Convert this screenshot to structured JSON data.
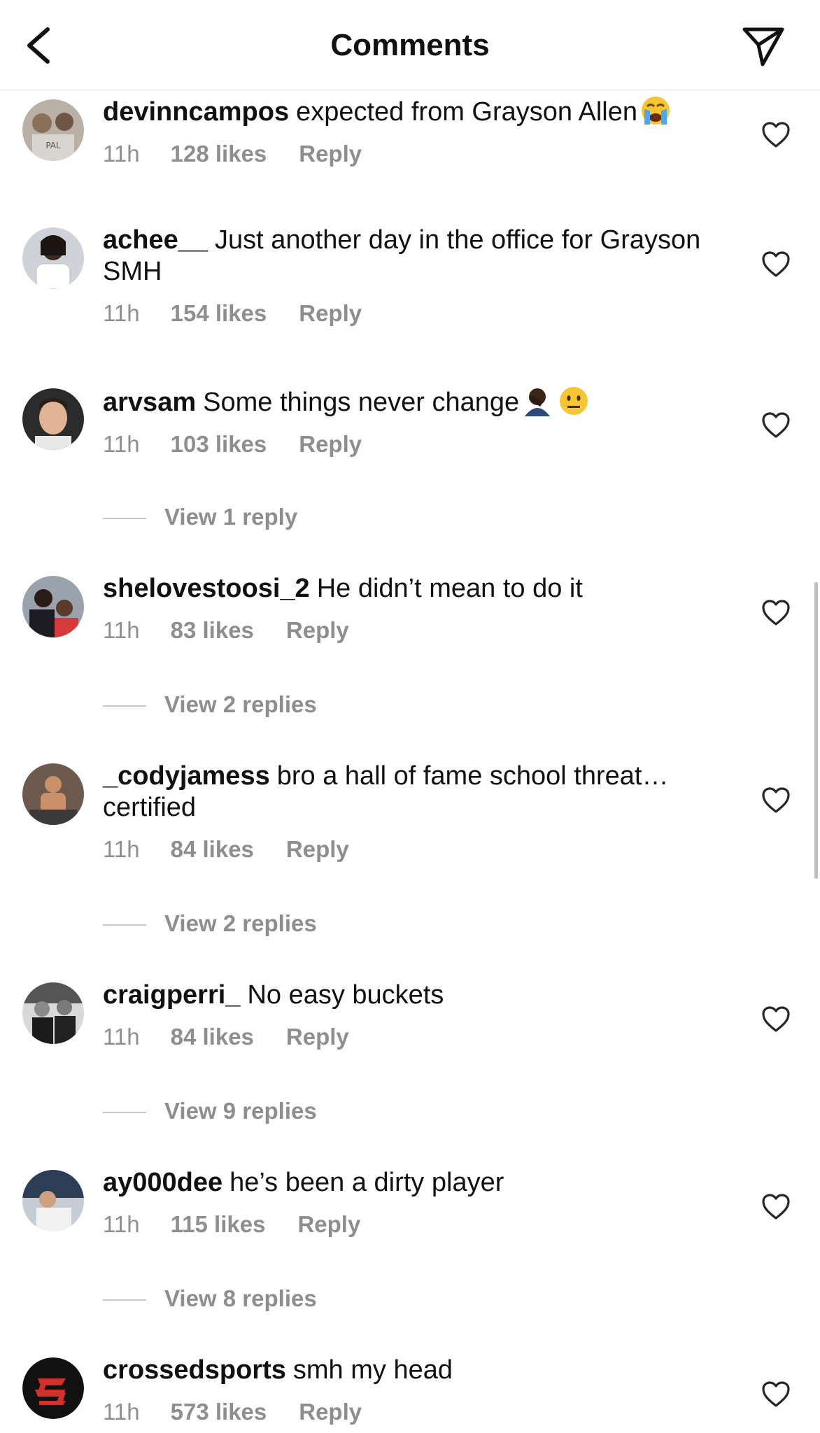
{
  "header": {
    "title": "Comments"
  },
  "comments": [
    {
      "username": "devinncampos",
      "text": "expected from Grayson Allen",
      "emoji": "crying",
      "time": "11h",
      "likes": "128 likes",
      "reply": "Reply",
      "view_replies": ""
    },
    {
      "username": "achee__",
      "text": "Just another day in the office for Grayson SMH",
      "emoji": "",
      "time": "11h",
      "likes": "154 likes",
      "reply": "Reply",
      "view_replies": ""
    },
    {
      "username": "arvsam",
      "text": "Some things never change",
      "emoji": "person-neutral",
      "time": "11h",
      "likes": "103 likes",
      "reply": "Reply",
      "view_replies": "View 1 reply"
    },
    {
      "username": "shelovestoosi_2",
      "text": "He didn’t mean to do it",
      "emoji": "",
      "time": "11h",
      "likes": "83 likes",
      "reply": "Reply",
      "view_replies": "View 2 replies"
    },
    {
      "username": "_codyjamess",
      "text": "bro a hall of fame school threat… certified",
      "emoji": "",
      "time": "11h",
      "likes": "84 likes",
      "reply": "Reply",
      "view_replies": "View 2 replies"
    },
    {
      "username": "craigperri_",
      "text": "No easy buckets",
      "emoji": "",
      "time": "11h",
      "likes": "84 likes",
      "reply": "Reply",
      "view_replies": "View 9 replies"
    },
    {
      "username": "ay000dee",
      "text": "he’s been a dirty player",
      "emoji": "",
      "time": "11h",
      "likes": "115 likes",
      "reply": "Reply",
      "view_replies": "View 8 replies"
    },
    {
      "username": "crossedsports",
      "text": "smh my head",
      "emoji": "",
      "time": "11h",
      "likes": "573 likes",
      "reply": "Reply",
      "view_replies": ""
    }
  ],
  "icons": {
    "back": "chevron-left-icon",
    "send": "paper-plane-icon",
    "like": "heart-outline-icon"
  },
  "colors": {
    "text": "#111111",
    "secondary": "#8e8e8e",
    "divider": "#e3e3e3",
    "brand_logo_red": "#d0312d"
  }
}
